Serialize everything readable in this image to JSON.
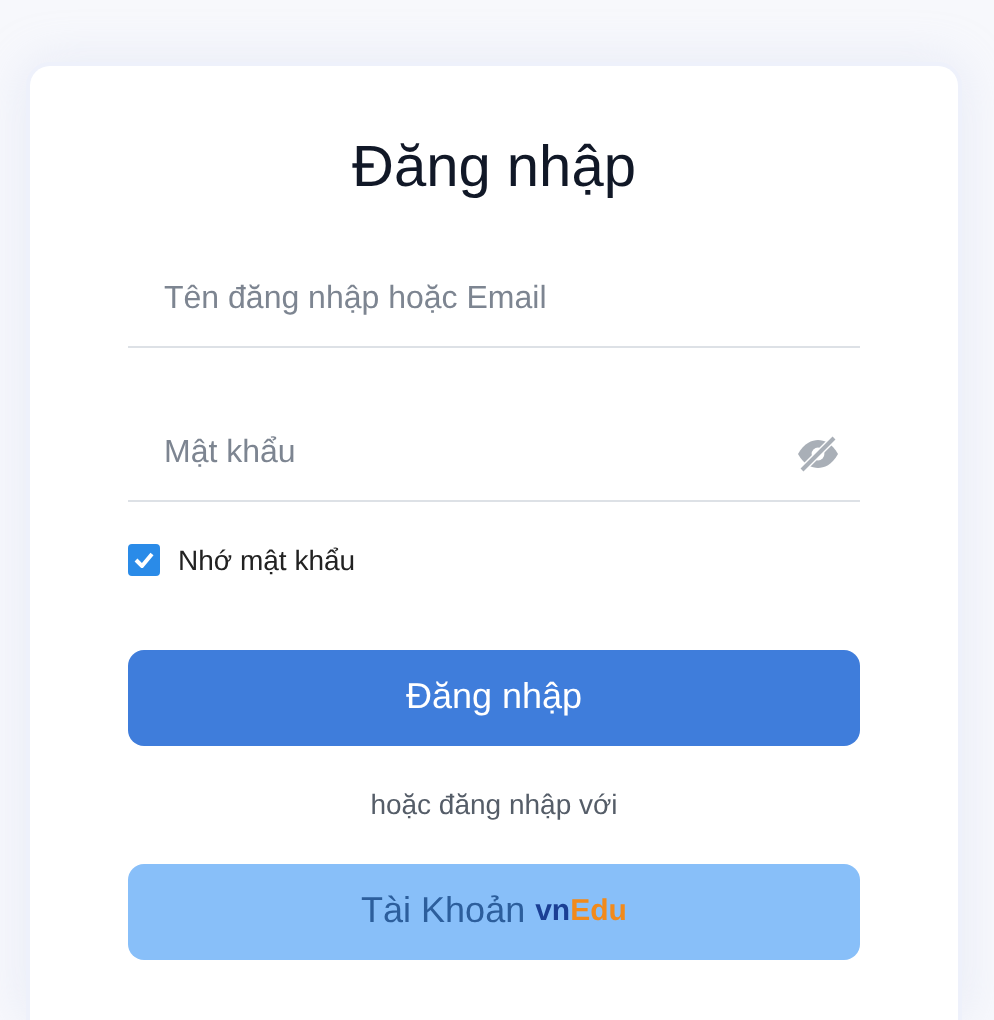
{
  "title": "Đăng nhập",
  "username_field": {
    "placeholder": "Tên đăng nhập hoặc Email"
  },
  "password_field": {
    "placeholder": "Mật khẩu",
    "password_hidden": true
  },
  "remember": {
    "label": "Nhớ mật khẩu",
    "checked": true
  },
  "login_button": "Đăng nhập",
  "divider_text": "hoặc đăng nhập với",
  "account_button": {
    "label": "Tài Khoản",
    "logo": {
      "part_1": "vn",
      "part_2": "Edu"
    }
  }
}
